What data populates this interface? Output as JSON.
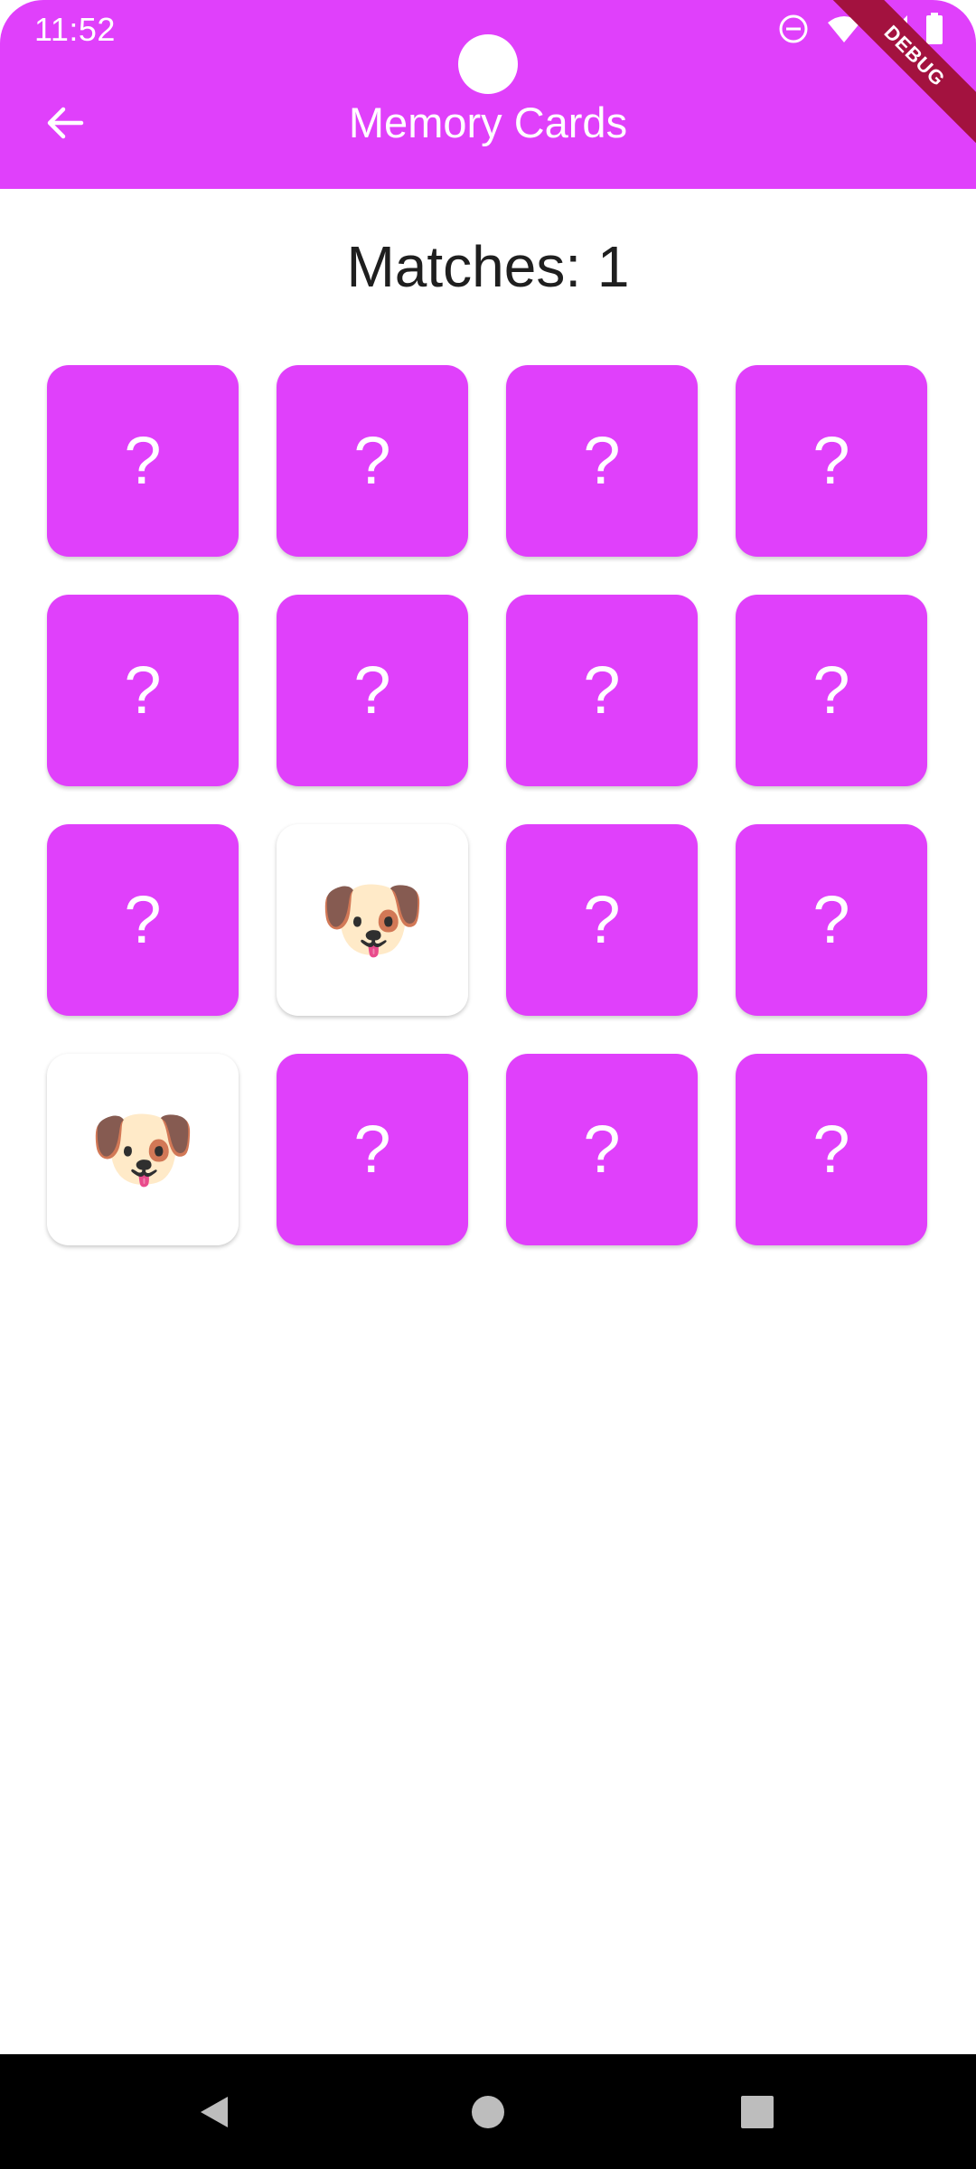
{
  "status_bar": {
    "time": "11:52",
    "icons": [
      "do-not-disturb-icon",
      "wifi-icon",
      "signal-icon",
      "battery-icon"
    ]
  },
  "debug_banner": "DEBUG",
  "app_bar": {
    "title": "Memory Cards",
    "back_icon": "arrow-back-icon",
    "color": "#e040fb"
  },
  "game": {
    "matches_text": "Matches: 1",
    "matches": 1,
    "hidden_symbol": "?",
    "card_back_color": "#e040fb",
    "cards": [
      {
        "face_up": false,
        "symbol": "?"
      },
      {
        "face_up": false,
        "symbol": "?"
      },
      {
        "face_up": false,
        "symbol": "?"
      },
      {
        "face_up": false,
        "symbol": "?"
      },
      {
        "face_up": false,
        "symbol": "?"
      },
      {
        "face_up": false,
        "symbol": "?"
      },
      {
        "face_up": false,
        "symbol": "?"
      },
      {
        "face_up": false,
        "symbol": "?"
      },
      {
        "face_up": false,
        "symbol": "?"
      },
      {
        "face_up": true,
        "symbol": "🐶",
        "icon": "shiba-dog-face-icon"
      },
      {
        "face_up": false,
        "symbol": "?"
      },
      {
        "face_up": false,
        "symbol": "?"
      },
      {
        "face_up": true,
        "symbol": "🐶",
        "icon": "shiba-dog-face-icon"
      },
      {
        "face_up": false,
        "symbol": "?"
      },
      {
        "face_up": false,
        "symbol": "?"
      },
      {
        "face_up": false,
        "symbol": "?"
      }
    ]
  },
  "nav_bar": {
    "buttons": [
      "back-triangle-icon",
      "home-circle-icon",
      "recents-square-icon"
    ]
  }
}
